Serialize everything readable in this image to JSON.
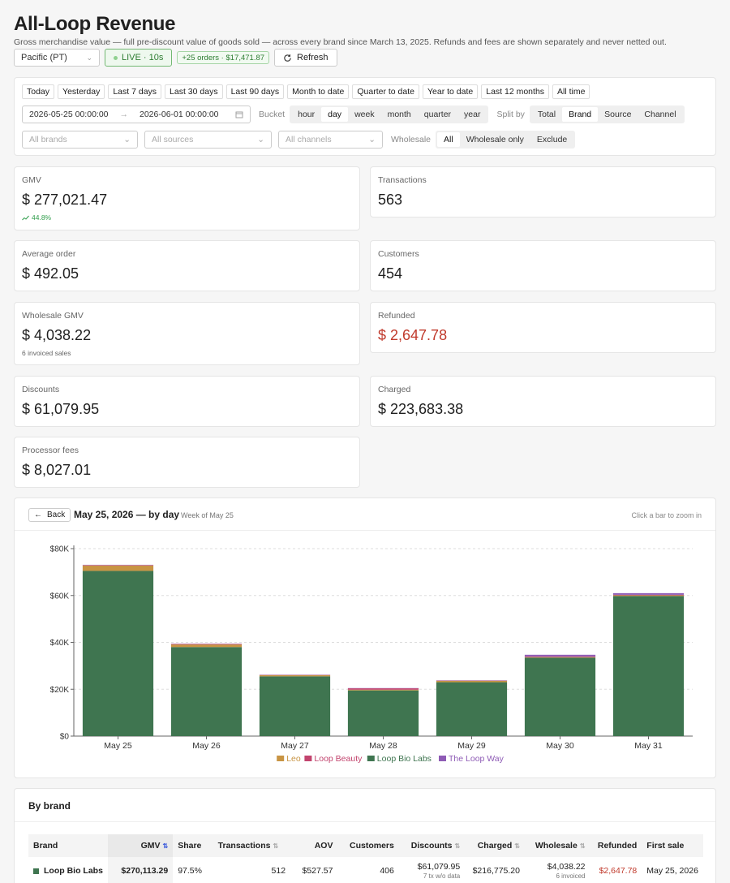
{
  "header": {
    "title": "All-Loop Revenue",
    "subtitle": "Gross merchandise value — full pre-discount value of goods sold — across every brand since March 13, 2025. Refunds and fees are shown separately and never netted out."
  },
  "controls": {
    "timezone": "Pacific (PT)",
    "live_label": "LIVE · 10s",
    "delta_badge": "+25 orders · $17,471.87",
    "refresh_label": "Refresh"
  },
  "filters": {
    "presets": [
      "Today",
      "Yesterday",
      "Last 7 days",
      "Last 30 days",
      "Last 90 days",
      "Month to date",
      "Quarter to date",
      "Year to date",
      "Last 12 months",
      "All time"
    ],
    "date_start": "2026-05-25 00:00:00",
    "date_end": "2026-06-01 00:00:00",
    "bucket_label": "Bucket",
    "buckets": [
      "hour",
      "day",
      "week",
      "month",
      "quarter",
      "year"
    ],
    "bucket_selected": "day",
    "split_label": "Split by",
    "splits": [
      "Total",
      "Brand",
      "Source",
      "Channel"
    ],
    "split_selected": "Brand",
    "brands_placeholder": "All brands",
    "sources_placeholder": "All sources",
    "channels_placeholder": "All channels",
    "wholesale_label": "Wholesale",
    "wholesale_options": [
      "All",
      "Wholesale only",
      "Exclude"
    ],
    "wholesale_selected": "All"
  },
  "metrics": {
    "gmv": {
      "label": "GMV",
      "value": "$ 277,021.47",
      "trend": "44.8%"
    },
    "transactions": {
      "label": "Transactions",
      "value": "563"
    },
    "aov": {
      "label": "Average order",
      "value": "$ 492.05"
    },
    "customers": {
      "label": "Customers",
      "value": "454"
    },
    "wholesale": {
      "label": "Wholesale GMV",
      "value": "$ 4,038.22",
      "note": "6 invoiced sales"
    },
    "refunded": {
      "label": "Refunded",
      "value": "$ 2,647.78"
    },
    "discounts": {
      "label": "Discounts",
      "value": "$ 61,079.95"
    },
    "charged": {
      "label": "Charged",
      "value": "$ 223,683.38"
    },
    "fees": {
      "label": "Processor fees",
      "value": "$ 8,027.01"
    }
  },
  "chart_panel": {
    "back_label": "Back",
    "title": "May 25, 2026 — by day",
    "week_label": "Week of May 25",
    "hint": "Click a bar to zoom in"
  },
  "chart_data": {
    "type": "bar",
    "stacked": true,
    "categories": [
      "May 25",
      "May 26",
      "May 27",
      "May 28",
      "May 29",
      "May 30",
      "May 31"
    ],
    "series": [
      {
        "name": "Loop Bio Labs",
        "color": "#3f7550",
        "values": [
          70500,
          38000,
          25500,
          19500,
          23000,
          33500,
          59800
        ]
      },
      {
        "name": "Leo",
        "color": "#c89443",
        "values": [
          2300,
          1100,
          500,
          300,
          600,
          200,
          300
        ]
      },
      {
        "name": "Loop Beauty",
        "color": "#c2446e",
        "values": [
          200,
          200,
          100,
          600,
          100,
          300,
          200
        ]
      },
      {
        "name": "The Loop Way",
        "color": "#8e5bb5",
        "values": [
          100,
          100,
          100,
          100,
          100,
          700,
          700
        ]
      }
    ],
    "legend_order": [
      "Leo",
      "Loop Beauty",
      "Loop Bio Labs",
      "The Loop Way"
    ],
    "y_ticks": [
      "$0",
      "$20K",
      "$40K",
      "$60K",
      "$80K"
    ],
    "ylim": [
      0,
      80000
    ],
    "grid": true,
    "legend": "bottom-center"
  },
  "brand_table": {
    "title": "By brand",
    "columns": [
      "Brand",
      "GMV",
      "Share",
      "Transactions",
      "AOV",
      "Customers",
      "Discounts",
      "Charged",
      "Wholesale",
      "Refunded",
      "First sale"
    ],
    "rows": [
      {
        "brand": "Loop Bio Labs",
        "color": "#3f7550",
        "gmv": "$270,113.29",
        "share": "97.5%",
        "transactions": "512",
        "aov": "$527.57",
        "customers": "406",
        "discounts": "$61,079.95",
        "discounts_note": "7 tx w/o data",
        "charged": "$216,775.20",
        "wholesale": "$4,038.22",
        "wholesale_note": "6 invoiced",
        "refunded": "$2,647.78",
        "first_sale": "May 25, 2026"
      }
    ]
  }
}
